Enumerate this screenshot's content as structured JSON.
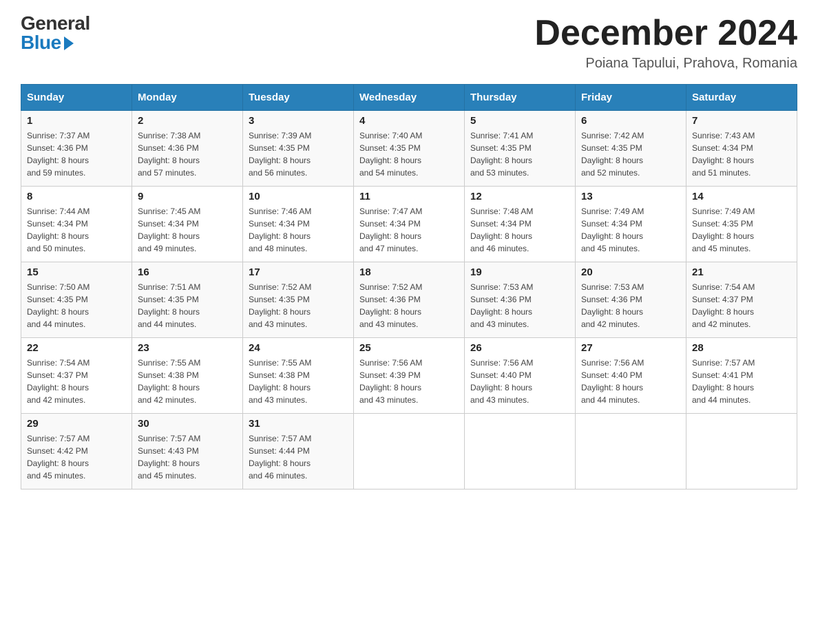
{
  "header": {
    "logo_general": "General",
    "logo_blue": "Blue",
    "month_title": "December 2024",
    "location": "Poiana Tapului, Prahova, Romania"
  },
  "days_of_week": [
    "Sunday",
    "Monday",
    "Tuesday",
    "Wednesday",
    "Thursday",
    "Friday",
    "Saturday"
  ],
  "weeks": [
    [
      {
        "day": "1",
        "sunrise": "7:37 AM",
        "sunset": "4:36 PM",
        "daylight": "8 hours and 59 minutes."
      },
      {
        "day": "2",
        "sunrise": "7:38 AM",
        "sunset": "4:36 PM",
        "daylight": "8 hours and 57 minutes."
      },
      {
        "day": "3",
        "sunrise": "7:39 AM",
        "sunset": "4:35 PM",
        "daylight": "8 hours and 56 minutes."
      },
      {
        "day": "4",
        "sunrise": "7:40 AM",
        "sunset": "4:35 PM",
        "daylight": "8 hours and 54 minutes."
      },
      {
        "day": "5",
        "sunrise": "7:41 AM",
        "sunset": "4:35 PM",
        "daylight": "8 hours and 53 minutes."
      },
      {
        "day": "6",
        "sunrise": "7:42 AM",
        "sunset": "4:35 PM",
        "daylight": "8 hours and 52 minutes."
      },
      {
        "day": "7",
        "sunrise": "7:43 AM",
        "sunset": "4:34 PM",
        "daylight": "8 hours and 51 minutes."
      }
    ],
    [
      {
        "day": "8",
        "sunrise": "7:44 AM",
        "sunset": "4:34 PM",
        "daylight": "8 hours and 50 minutes."
      },
      {
        "day": "9",
        "sunrise": "7:45 AM",
        "sunset": "4:34 PM",
        "daylight": "8 hours and 49 minutes."
      },
      {
        "day": "10",
        "sunrise": "7:46 AM",
        "sunset": "4:34 PM",
        "daylight": "8 hours and 48 minutes."
      },
      {
        "day": "11",
        "sunrise": "7:47 AM",
        "sunset": "4:34 PM",
        "daylight": "8 hours and 47 minutes."
      },
      {
        "day": "12",
        "sunrise": "7:48 AM",
        "sunset": "4:34 PM",
        "daylight": "8 hours and 46 minutes."
      },
      {
        "day": "13",
        "sunrise": "7:49 AM",
        "sunset": "4:34 PM",
        "daylight": "8 hours and 45 minutes."
      },
      {
        "day": "14",
        "sunrise": "7:49 AM",
        "sunset": "4:35 PM",
        "daylight": "8 hours and 45 minutes."
      }
    ],
    [
      {
        "day": "15",
        "sunrise": "7:50 AM",
        "sunset": "4:35 PM",
        "daylight": "8 hours and 44 minutes."
      },
      {
        "day": "16",
        "sunrise": "7:51 AM",
        "sunset": "4:35 PM",
        "daylight": "8 hours and 44 minutes."
      },
      {
        "day": "17",
        "sunrise": "7:52 AM",
        "sunset": "4:35 PM",
        "daylight": "8 hours and 43 minutes."
      },
      {
        "day": "18",
        "sunrise": "7:52 AM",
        "sunset": "4:36 PM",
        "daylight": "8 hours and 43 minutes."
      },
      {
        "day": "19",
        "sunrise": "7:53 AM",
        "sunset": "4:36 PM",
        "daylight": "8 hours and 43 minutes."
      },
      {
        "day": "20",
        "sunrise": "7:53 AM",
        "sunset": "4:36 PM",
        "daylight": "8 hours and 42 minutes."
      },
      {
        "day": "21",
        "sunrise": "7:54 AM",
        "sunset": "4:37 PM",
        "daylight": "8 hours and 42 minutes."
      }
    ],
    [
      {
        "day": "22",
        "sunrise": "7:54 AM",
        "sunset": "4:37 PM",
        "daylight": "8 hours and 42 minutes."
      },
      {
        "day": "23",
        "sunrise": "7:55 AM",
        "sunset": "4:38 PM",
        "daylight": "8 hours and 42 minutes."
      },
      {
        "day": "24",
        "sunrise": "7:55 AM",
        "sunset": "4:38 PM",
        "daylight": "8 hours and 43 minutes."
      },
      {
        "day": "25",
        "sunrise": "7:56 AM",
        "sunset": "4:39 PM",
        "daylight": "8 hours and 43 minutes."
      },
      {
        "day": "26",
        "sunrise": "7:56 AM",
        "sunset": "4:40 PM",
        "daylight": "8 hours and 43 minutes."
      },
      {
        "day": "27",
        "sunrise": "7:56 AM",
        "sunset": "4:40 PM",
        "daylight": "8 hours and 44 minutes."
      },
      {
        "day": "28",
        "sunrise": "7:57 AM",
        "sunset": "4:41 PM",
        "daylight": "8 hours and 44 minutes."
      }
    ],
    [
      {
        "day": "29",
        "sunrise": "7:57 AM",
        "sunset": "4:42 PM",
        "daylight": "8 hours and 45 minutes."
      },
      {
        "day": "30",
        "sunrise": "7:57 AM",
        "sunset": "4:43 PM",
        "daylight": "8 hours and 45 minutes."
      },
      {
        "day": "31",
        "sunrise": "7:57 AM",
        "sunset": "4:44 PM",
        "daylight": "8 hours and 46 minutes."
      },
      null,
      null,
      null,
      null
    ]
  ],
  "labels": {
    "sunrise": "Sunrise:",
    "sunset": "Sunset:",
    "daylight": "Daylight:"
  }
}
